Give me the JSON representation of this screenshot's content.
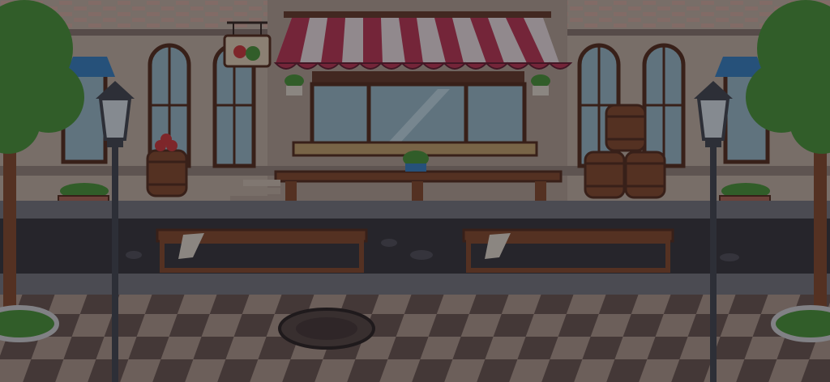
{
  "scene": {
    "name": "market-street-background",
    "dimmed": true,
    "palette": {
      "wall": "#c9b7a6",
      "wall_shadow": "#9c8a7e",
      "brick": "#b36a57",
      "wood": "#8a4e2d",
      "wood_dark": "#5a311e",
      "awning_red": "#c23a55",
      "awning_white": "#f3e6e6",
      "glass": "#9fc0cc",
      "road": "#3b3a3d",
      "sidewalk": "#7a7b80",
      "tile_light": "#b49d8d",
      "tile_dark": "#6f5b52",
      "tree": "#4f9a3a",
      "lamp": "#474b52"
    },
    "sign_icon": "fruit-sign-icon"
  }
}
